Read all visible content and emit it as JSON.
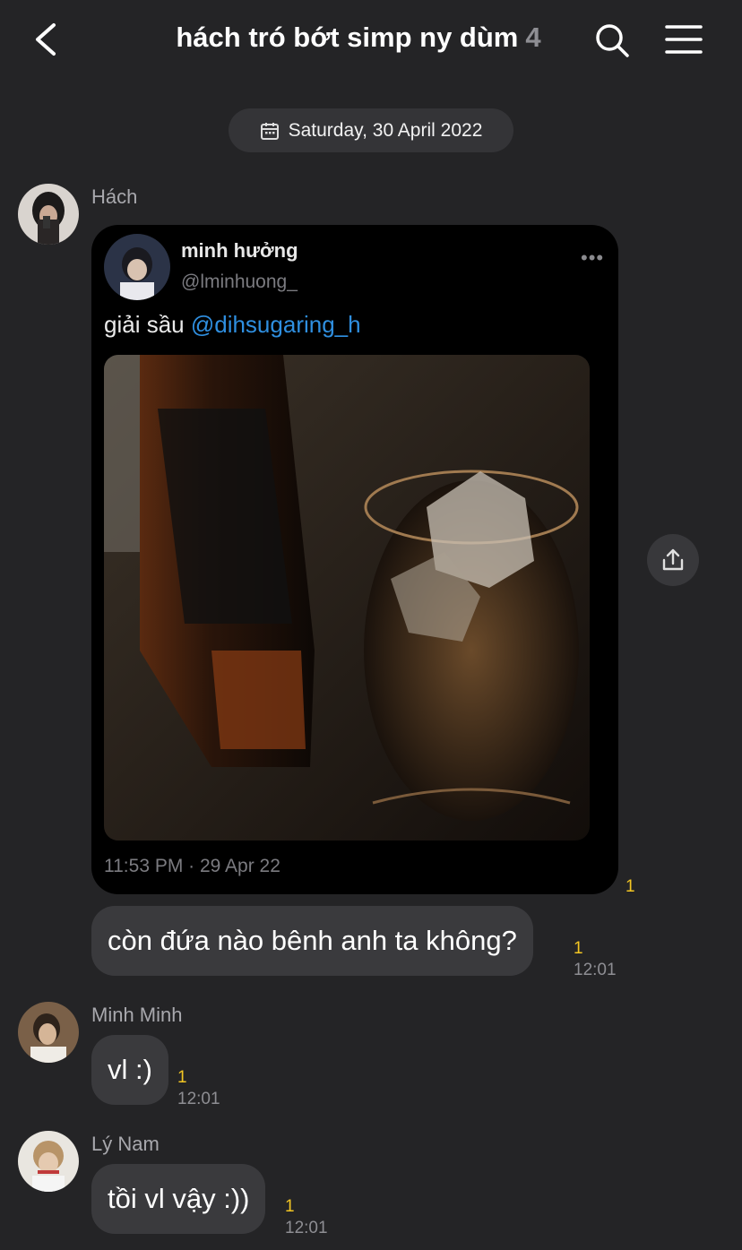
{
  "header": {
    "title": "hách tró bớt simp ny dùm",
    "member_count": "4"
  },
  "date_separator": "Saturday, 30 April 2022",
  "messages": [
    {
      "sender": "Hách",
      "tweet": {
        "name": "minh hưởng",
        "handle": "@lminhuong_",
        "text": "giải sầu ",
        "mention": "@dihsugaring_h",
        "more": "•••",
        "timestamp": "11:53 PM · 29 Apr 22"
      },
      "tweet_unread": "1",
      "text": "còn đứa nào bênh anh ta không?",
      "unread": "1",
      "time": "12:01"
    },
    {
      "sender": "Minh Minh",
      "text": "vl :)",
      "unread": "1",
      "time": "12:01"
    },
    {
      "sender": "Lý Nam",
      "text": "tồi vl vậy :))",
      "unread": "1",
      "time": "12:01"
    }
  ],
  "icons": {
    "back": "chevron-left-icon",
    "search": "search-icon",
    "menu": "hamburger-menu-icon",
    "calendar": "calendar-icon",
    "share": "share-icon"
  }
}
